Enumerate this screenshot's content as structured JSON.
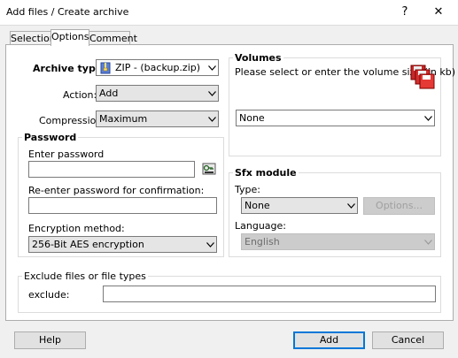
{
  "window": {
    "title": "Add files / Create archive",
    "help_glyph": "?",
    "close_glyph": "✕"
  },
  "tabs": [
    {
      "label": "Selection"
    },
    {
      "label": "Options"
    },
    {
      "label": "Comment"
    }
  ],
  "archive_type": {
    "label": "Archive type:",
    "value": "ZIP - (backup.zip)"
  },
  "action": {
    "label": "Action:",
    "value": "Add"
  },
  "compression": {
    "label": "Compression:",
    "value": "Maximum"
  },
  "password": {
    "group_title": "Password",
    "enter_label": "Enter password",
    "enter_value": "",
    "reenter_label": "Re-enter password for confirmation:",
    "reenter_value": "",
    "encryption_label": "Encryption method:",
    "encryption_value": "256-Bit AES encryption"
  },
  "volumes": {
    "group_title": "Volumes",
    "description": "Please select or enter the volume size (in kb)",
    "value": "None"
  },
  "sfx": {
    "group_title": "Sfx module",
    "type_label": "Type:",
    "type_value": "None",
    "options_button": "Options...",
    "language_label": "Language:",
    "language_value": "English"
  },
  "exclude": {
    "group_title": "Exclude files or file types",
    "label": "exclude:",
    "value": ""
  },
  "buttons": {
    "help": "Help",
    "add": "Add",
    "cancel": "Cancel"
  },
  "colors": {
    "accent": "#0078d7",
    "dialog_bg": "#f0f0f0"
  }
}
